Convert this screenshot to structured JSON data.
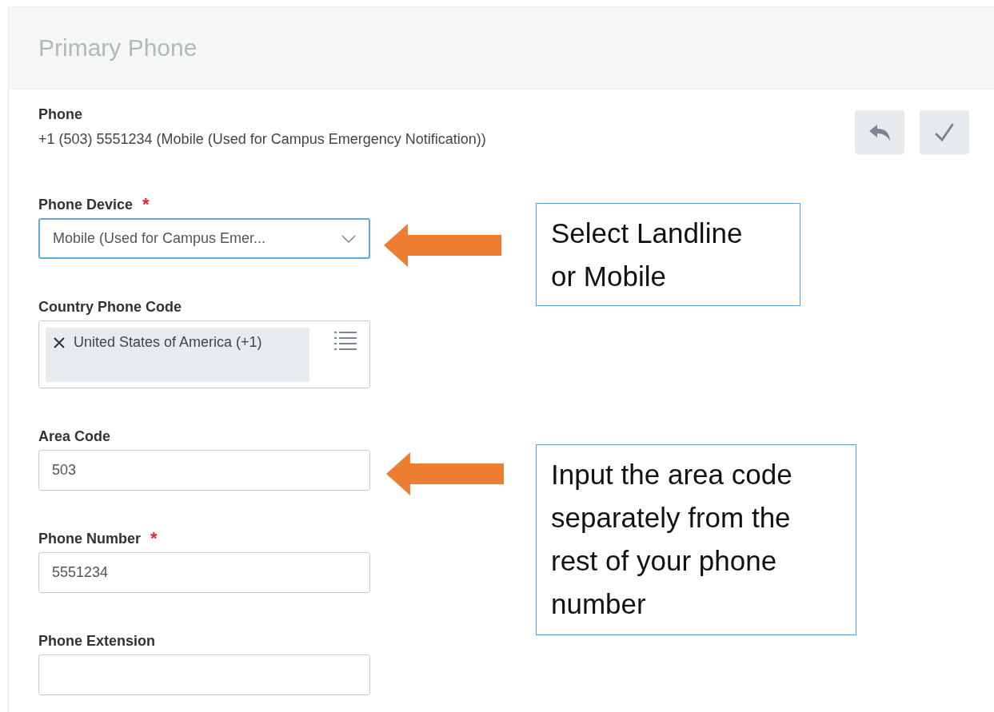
{
  "section": {
    "title": "Primary Phone"
  },
  "phone": {
    "label": "Phone",
    "value": "+1 (503) 5551234 (Mobile (Used for Campus Emergency Notification))"
  },
  "fields": [
    {
      "kind": "select",
      "label": "Phone Device",
      "required": true,
      "focused": true,
      "value": "Mobile (Used for Campus Emer..."
    },
    {
      "kind": "multiselect",
      "label": "Country Phone Code",
      "required": false,
      "focused": false,
      "value": "United States of America (+1)"
    },
    {
      "kind": "text",
      "label": "Area Code",
      "required": false,
      "focused": false,
      "value": "503"
    },
    {
      "kind": "text",
      "label": "Phone Number",
      "required": true,
      "focused": false,
      "value": "5551234"
    },
    {
      "kind": "text",
      "label": "Phone Extension",
      "required": false,
      "focused": false
    }
  ],
  "required_mark": "*",
  "callouts": [
    {
      "text": "Select Landline or Mobile"
    },
    {
      "text": "Input the area code separately from the rest of your phone number"
    }
  ]
}
